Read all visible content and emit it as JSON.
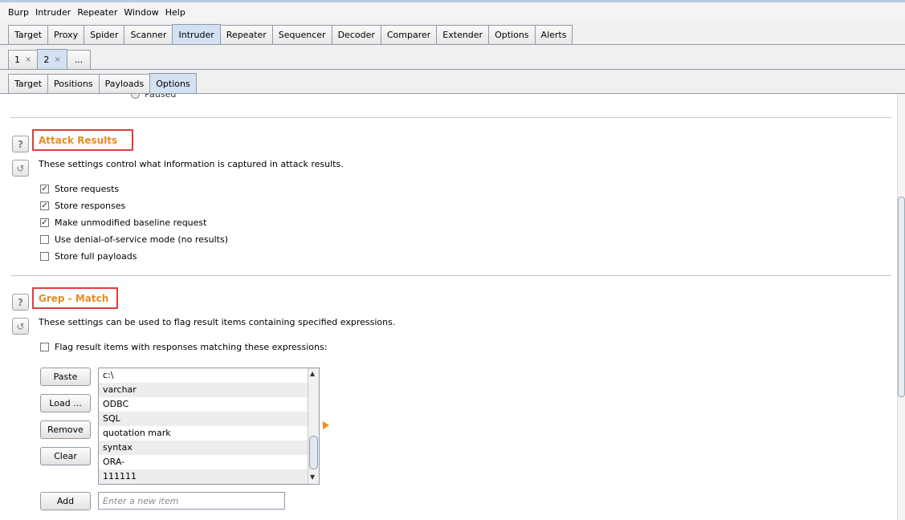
{
  "menu": [
    "Burp",
    "Intruder",
    "Repeater",
    "Window",
    "Help"
  ],
  "main_tabs": [
    "Target",
    "Proxy",
    "Spider",
    "Scanner",
    "Intruder",
    "Repeater",
    "Sequencer",
    "Decoder",
    "Comparer",
    "Extender",
    "Options",
    "Alerts"
  ],
  "main_tab_active": "Intruder",
  "instance_tabs": [
    {
      "label": "1",
      "close": "×"
    },
    {
      "label": "2",
      "close": "×"
    },
    {
      "label": "..."
    }
  ],
  "instance_tab_active": "2",
  "sub_tabs": [
    "Target",
    "Positions",
    "Payloads",
    "Options"
  ],
  "sub_tab_active": "Options",
  "partial_radio_label": "Paused",
  "attack_results": {
    "help": "?",
    "reset": "↺",
    "title": "Attack Results",
    "description": "These settings control what information is captured in attack results.",
    "options": [
      {
        "label": "Store requests",
        "checked": true
      },
      {
        "label": "Store responses",
        "checked": true
      },
      {
        "label": "Make unmodified baseline request",
        "checked": true
      },
      {
        "label": "Use denial-of-service mode (no results)",
        "checked": false
      },
      {
        "label": "Store full payloads",
        "checked": false
      }
    ]
  },
  "grep_match": {
    "help": "?",
    "reset": "↺",
    "title": "Grep - Match",
    "description": "These settings can be used to flag result items containing specified expressions.",
    "flag_label": "Flag result items with responses matching these expressions:",
    "flag_checked": false,
    "buttons": {
      "paste": "Paste",
      "load": "Load ...",
      "remove": "Remove",
      "clear": "Clear",
      "add": "Add"
    },
    "items": [
      "c:\\",
      "varchar",
      "ODBC",
      "SQL",
      "quotation mark",
      "syntax",
      "ORA-",
      "111111"
    ],
    "new_item_placeholder": "Enter a new item"
  },
  "check_mark": "✓",
  "colors": {
    "title": "#e58c24",
    "highlight_box": "#e23c3c",
    "active_tab": "#d3e1f2"
  }
}
